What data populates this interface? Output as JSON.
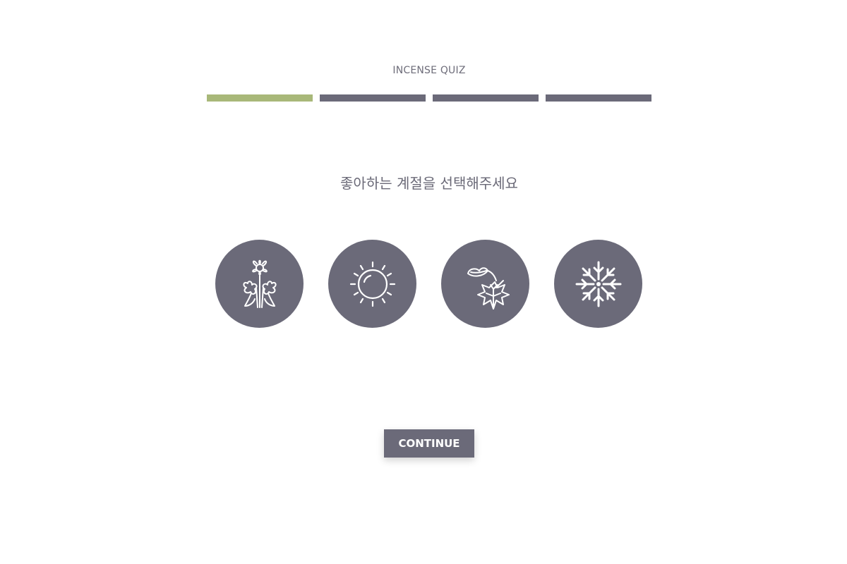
{
  "header": {
    "title": "INCENSE QUIZ"
  },
  "progress": {
    "total_steps": 4,
    "current_step": 1,
    "active_color": "#a8b879",
    "inactive_color": "#6b6a79"
  },
  "question": {
    "text": "좋아하는 계절을 선택해주세요"
  },
  "options": [
    {
      "icon": "flower-icon",
      "season": "spring"
    },
    {
      "icon": "sun-icon",
      "season": "summer"
    },
    {
      "icon": "maple-leaf-icon",
      "season": "autumn"
    },
    {
      "icon": "snowflake-icon",
      "season": "winter"
    }
  ],
  "actions": {
    "continue_label": "CONTINUE"
  },
  "colors": {
    "accent": "#a8b879",
    "primary": "#6b6a79",
    "text": "#6a6977"
  }
}
